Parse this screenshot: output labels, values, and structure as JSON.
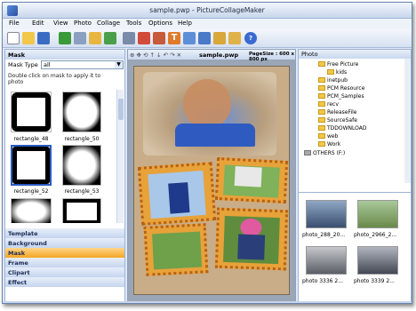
{
  "window": {
    "title": "sample.pwp - PictureCollageMaker"
  },
  "menu": [
    "File",
    "Edit",
    "View",
    "Photo",
    "Collage",
    "Tools",
    "Options",
    "Help"
  ],
  "left_panel": {
    "header": "Mask",
    "mask_type_label": "Mask Type",
    "mask_type_value": "all",
    "hint": "Double click on mask to apply it to photo",
    "thumbs": [
      "rectangle_48",
      "rectangle_50",
      "rectangle_52",
      "rectangle_53"
    ],
    "categories": [
      "Template",
      "Background",
      "Mask",
      "Frame",
      "Clipart",
      "Effect"
    ],
    "selected_category": "Mask"
  },
  "center": {
    "filename": "sample.pwp",
    "page_size": "PageSize : 600 x 800 px"
  },
  "right_panel": {
    "header": "Photo",
    "tree": [
      "Free Picture",
      "kids",
      "inetpub",
      "PCM Resource",
      "PCM_Samples",
      "recv",
      "ReleaseFile",
      "SourceSafe",
      "TDDOWNLOAD",
      "web",
      "Work",
      "OTHERS (F:)"
    ],
    "photos": [
      "photo_288_20...",
      "photo_2966_2...",
      "photo 3336 2...",
      "photo 3339 2..."
    ]
  },
  "colors": {
    "accent": "#f5a623",
    "panel": "#dfe8f6"
  }
}
